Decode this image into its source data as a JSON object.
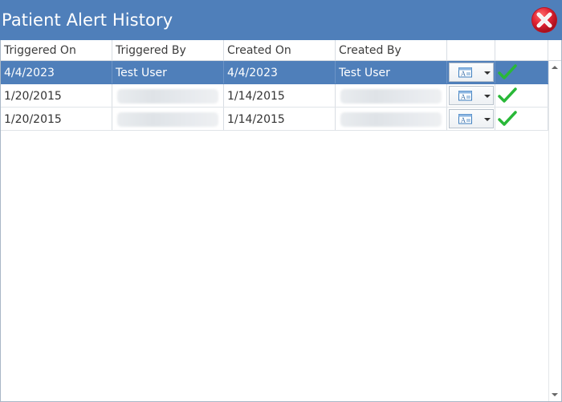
{
  "window": {
    "title": "Patient Alert History"
  },
  "table": {
    "columns": [
      "Triggered On",
      "Triggered By",
      "Created On",
      "Created By",
      "",
      ""
    ],
    "rows": [
      {
        "triggered_on": "4/4/2023",
        "triggered_by": "Test User",
        "created_on": "4/4/2023",
        "created_by": "Test User",
        "selected": true,
        "status": "acknowledged"
      },
      {
        "triggered_on": "1/20/2015",
        "triggered_by": "",
        "created_on": "1/14/2015",
        "created_by": "",
        "selected": false,
        "status": "acknowledged"
      },
      {
        "triggered_on": "1/20/2015",
        "triggered_by": "",
        "created_on": "1/14/2015",
        "created_by": "",
        "selected": false,
        "status": "acknowledged"
      }
    ]
  },
  "icons": {
    "close": "close-icon",
    "document": "document-icon",
    "dropdown": "chevron-down-icon",
    "check": "check-icon",
    "scroll_up": "scroll-up-icon",
    "scroll_down": "scroll-down-icon"
  },
  "colors": {
    "titlebar": "#4f7fba",
    "selection": "#4f7fba",
    "close_red": "#d71f2b",
    "check_green": "#28b838"
  }
}
